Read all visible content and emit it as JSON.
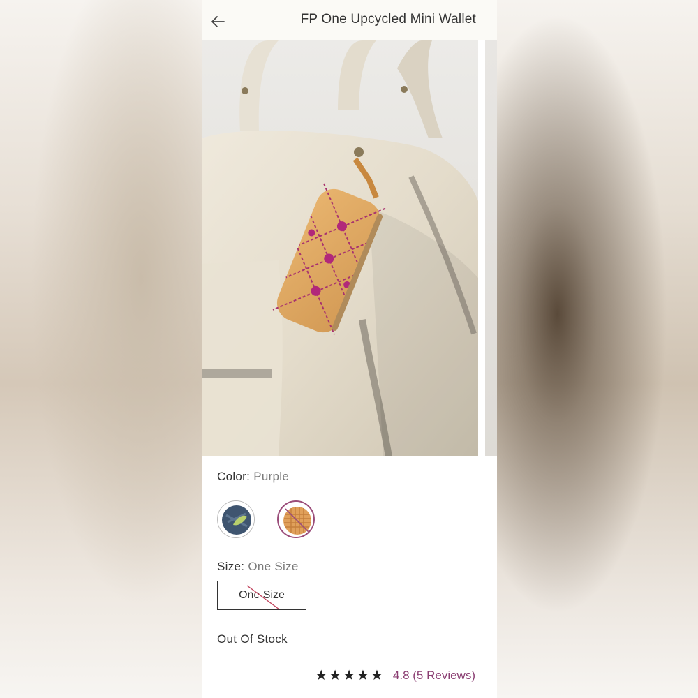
{
  "header": {
    "title": "FP One Upcycled Mini Wallet",
    "back_icon": "arrow-left-icon"
  },
  "product_image": {
    "alt": "Upcycled mini wallet clipped to a cream leather bag"
  },
  "color": {
    "label": "Color:",
    "value": "Purple",
    "swatches": [
      {
        "name": "denim-green",
        "selected": false,
        "available": true
      },
      {
        "name": "purple",
        "selected": true,
        "available": false
      }
    ]
  },
  "size": {
    "label": "Size:",
    "value": "One Size",
    "option_label": "One Size",
    "available": false
  },
  "stock_status": "Out Of Stock",
  "rating": {
    "stars": "★★★★★",
    "text": "4.8 (5 Reviews)",
    "value": 4.8,
    "count": 5
  },
  "colors": {
    "accent": "#8b3f73",
    "text": "#333333",
    "muted": "#7a7a7a"
  }
}
